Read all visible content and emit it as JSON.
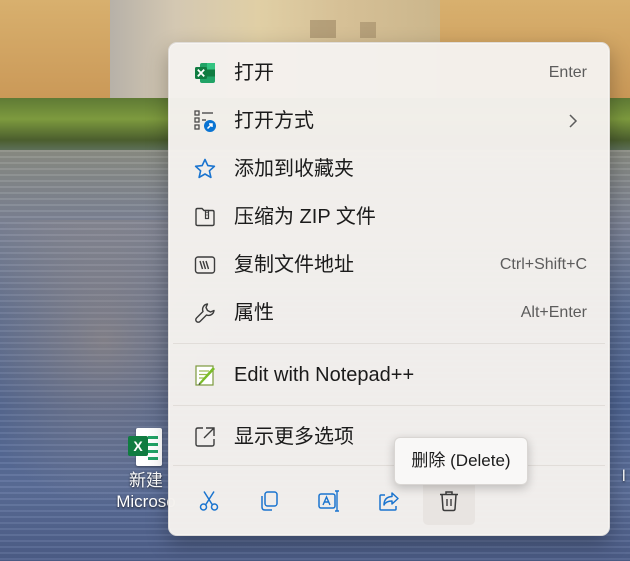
{
  "desktop": {
    "file_label_line1": "新建",
    "file_label_line2": "Microso",
    "file_badge": "X",
    "edge_glyph": "l"
  },
  "menu": {
    "items": [
      {
        "label": "打开",
        "shortcut": "Enter",
        "icon": "excel-icon"
      },
      {
        "label": "打开方式",
        "shortcut": "",
        "icon": "open-with-icon",
        "submenu": true
      },
      {
        "label": "添加到收藏夹",
        "shortcut": "",
        "icon": "star-icon"
      },
      {
        "label": "压缩为 ZIP 文件",
        "shortcut": "",
        "icon": "zip-folder-icon"
      },
      {
        "label": "复制文件地址",
        "shortcut": "Ctrl+Shift+C",
        "icon": "copy-path-icon"
      },
      {
        "label": "属性",
        "shortcut": "Alt+Enter",
        "icon": "wrench-icon"
      }
    ],
    "notepad": {
      "label": "Edit with Notepad++",
      "icon": "notepad-plus-plus-icon"
    },
    "more": {
      "label": "显示更多选项",
      "icon": "show-more-options-icon"
    },
    "toolbar": [
      {
        "name": "cut",
        "icon": "scissors-icon"
      },
      {
        "name": "copy",
        "icon": "copy-icon"
      },
      {
        "name": "rename",
        "icon": "rename-icon"
      },
      {
        "name": "share",
        "icon": "share-icon"
      },
      {
        "name": "delete",
        "icon": "trash-icon"
      }
    ]
  },
  "tooltip": {
    "text": "删除 (Delete)"
  },
  "colors": {
    "accent": "#0067c0",
    "excel_green": "#107c41"
  }
}
